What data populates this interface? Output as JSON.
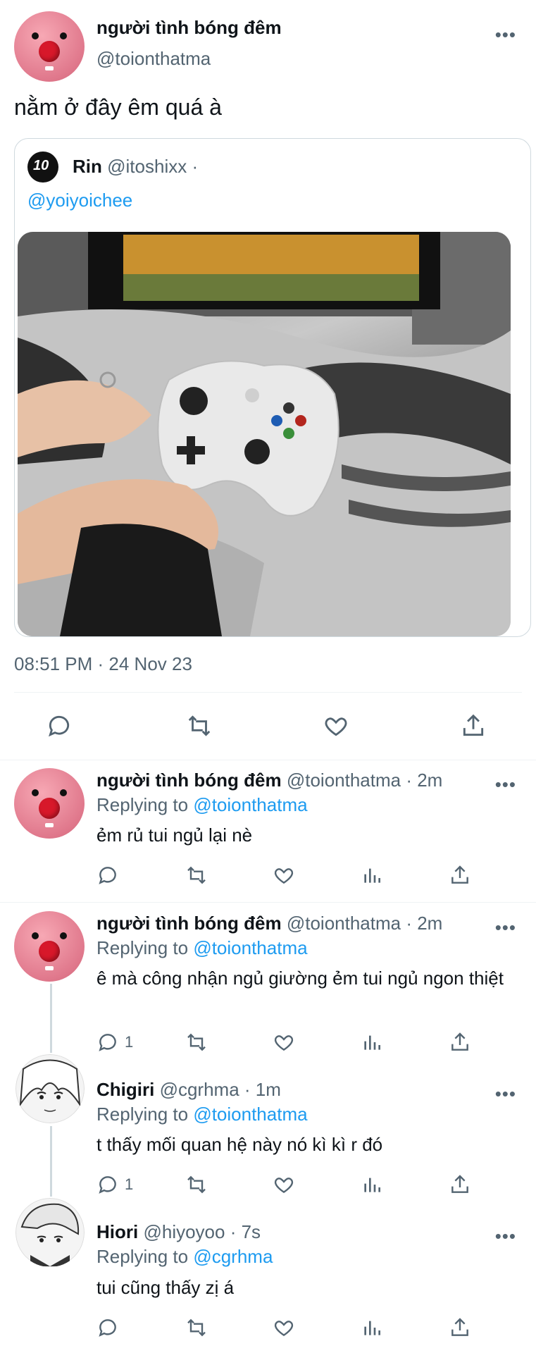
{
  "main_tweet": {
    "display_name": "người tình bóng đêm",
    "handle": "@toionthatma",
    "text": "nằm ở đây êm quá à",
    "quote": {
      "display_name": "Rin",
      "handle": "@itoshixx ·",
      "text": "@yoiyoichee",
      "avatar_badge": "10"
    },
    "timestamp": "08:51 PM · 24 Nov 23"
  },
  "replies": [
    {
      "display_name": "người tình bóng đêm",
      "handle_time": "@toionthatma · 2m",
      "replying_prefix": "Replying to",
      "replying_to": "@toionthatma",
      "text": "ẻm rủ tui ngủ lại nè",
      "reply_count": ""
    },
    {
      "display_name": "người tình bóng đêm",
      "handle_time": "@toionthatma · 2m",
      "replying_prefix": "Replying to",
      "replying_to": "@toionthatma",
      "text": "ê mà công nhận ngủ giường ẻm tui ngủ ngon thiệt",
      "reply_count": "1"
    },
    {
      "display_name": "Chigiri",
      "handle_time": "@cgrhma · 1m",
      "replying_prefix": "Replying to",
      "replying_to": "@toionthatma",
      "text": "t thấy mối quan hệ này nó kì kì r đó",
      "reply_count": "1"
    },
    {
      "display_name": "Hiori",
      "handle_time": "@hiyoyoo · 7s",
      "replying_prefix": "Replying to",
      "replying_to": "@cgrhma",
      "text": "tui cũng thấy zị á",
      "reply_count": ""
    }
  ],
  "more_label": "•••",
  "colors": {
    "accent": "#1d9bf0",
    "muted": "#536471",
    "text": "#0f1419",
    "divider": "#eff3f4"
  }
}
